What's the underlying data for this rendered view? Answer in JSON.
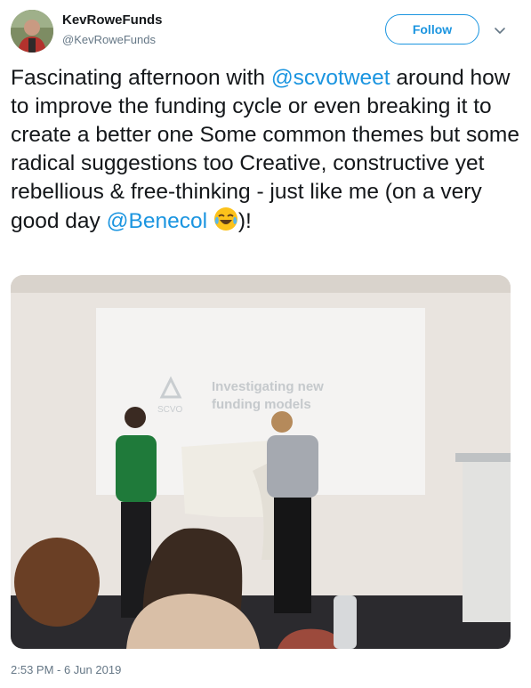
{
  "user": {
    "display_name": "KevRoweFunds",
    "handle": "@KevRoweFunds"
  },
  "follow_label": "Follow",
  "tweet": {
    "text_1": "Fascinating afternoon with ",
    "mention_1": "@scvotweet",
    "text_2": " around how to improve the funding cycle or even breaking it to create a better one Some common themes but some radical suggestions too Creative, constructive yet rebellious & free-thinking - just like me (on a very good day ",
    "mention_2": "@Benecol",
    "text_3": ")!",
    "emoji": "face-with-tears-of-joy"
  },
  "media": {
    "slide_brand": "SCVO",
    "slide_title_line1": "Investigating new",
    "slide_title_line2": "funding models"
  },
  "timestamp": "2:53 PM - 6 Jun 2019",
  "colors": {
    "accent": "#1b95e0",
    "text": "#14171a",
    "secondary": "#657786"
  }
}
